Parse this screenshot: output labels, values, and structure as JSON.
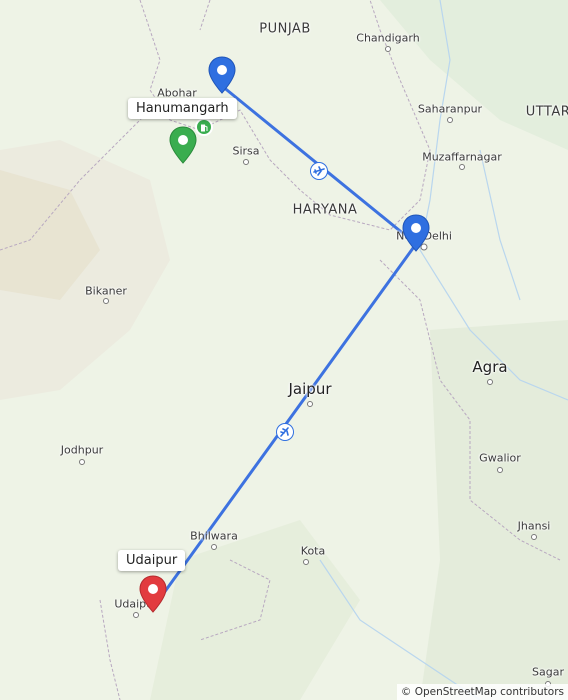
{
  "map": {
    "labels": {
      "punjab": "PUNJAB",
      "haryana": "HARYANA",
      "uttar": "UTTAR",
      "chandigarh": "Chandigarh",
      "abohar": "Abohar",
      "saharanpur": "Saharanpur",
      "sirsa": "Sirsa",
      "muzaffarnagar": "Muzaffarnagar",
      "new_delhi": "New Delhi",
      "bikaner": "Bikaner",
      "agra": "Agra",
      "jaipur": "Jaipur",
      "jodhpur": "Jodhpur",
      "gwalior": "Gwalior",
      "bhilwara": "Bhilwara",
      "jhansi": "Jhansi",
      "kota": "Kota",
      "udaipur_city": "Udaipur",
      "sagar": "Sagar"
    },
    "markers": {
      "hanumangarh": "Hanumangarh",
      "udaipur": "Udaipur"
    },
    "attribution": "© OpenStreetMap contributors",
    "colors": {
      "route": "#3d72e0",
      "start_pin": "#3aad4f",
      "end_pin": "#e23b3f",
      "stop_pin": "#2f6fe0",
      "land": "#eef3e6",
      "desert": "#eae8da"
    },
    "icons": {
      "plane": "airplane-icon",
      "fuel": "fuel-station-icon"
    }
  }
}
